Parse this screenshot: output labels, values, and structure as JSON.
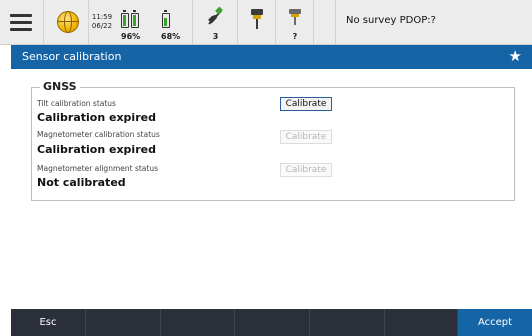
{
  "status": {
    "time": "11:59",
    "date": "06/22",
    "battery1": "96%",
    "battery2": "68%",
    "satellites": "3",
    "receiver2_status": "?",
    "survey_status": "No survey  PDOP:?"
  },
  "titlebar": {
    "title": "Sensor calibration",
    "favorite_icon": "star-icon"
  },
  "group": {
    "legend": "GNSS",
    "rows": [
      {
        "label": "Tilt calibration status",
        "value": "Calibration expired",
        "button": "Calibrate",
        "enabled": true
      },
      {
        "label": "Magnetometer calibration status",
        "value": "Calibration expired",
        "button": "Calibrate",
        "enabled": false
      },
      {
        "label": "Magnetometer alignment status",
        "value": "Not calibrated",
        "button": "Calibrate",
        "enabled": false
      }
    ]
  },
  "bottombar": {
    "esc": "Esc",
    "accept": "Accept"
  },
  "colors": {
    "accent": "#1565a6",
    "bottombar": "#2b2f3a",
    "battery": "#3aa12c"
  }
}
